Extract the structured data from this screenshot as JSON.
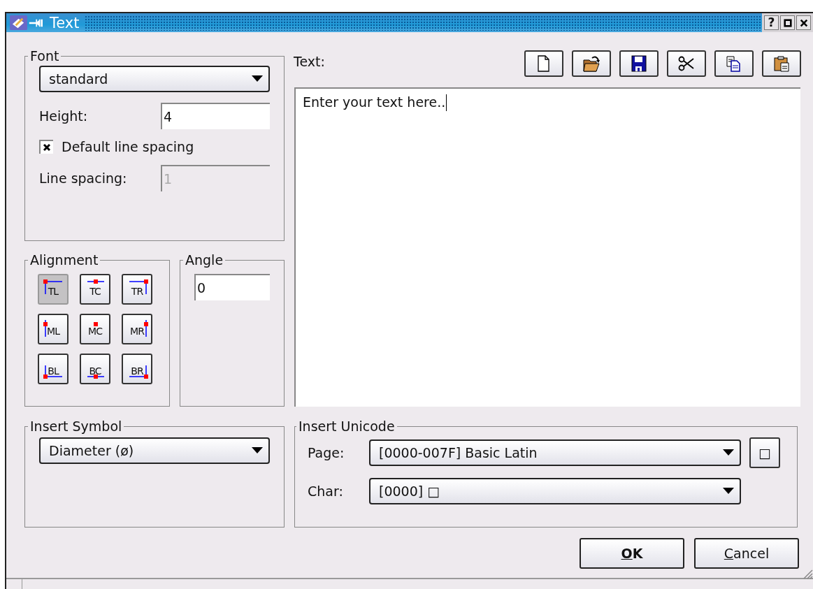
{
  "window": {
    "title": "Text"
  },
  "title_buttons": [
    {
      "kind": "help",
      "label": "?"
    },
    {
      "kind": "maximize"
    },
    {
      "kind": "close"
    }
  ],
  "font_group": {
    "title": "Font",
    "font": {
      "value": "standard"
    },
    "height": {
      "label": "Height:",
      "value": "4"
    },
    "default_spacing": {
      "label": "Default line spacing",
      "checked": true
    },
    "line_spacing": {
      "label": "Line spacing:",
      "value": "1",
      "disabled": true
    }
  },
  "alignment_group": {
    "title": "Alignment",
    "buttons": [
      {
        "label": "TL",
        "selected": true
      },
      {
        "label": "TC",
        "selected": false
      },
      {
        "label": "TR",
        "selected": false
      },
      {
        "label": "ML",
        "selected": false
      },
      {
        "label": "MC",
        "selected": false
      },
      {
        "label": "MR",
        "selected": false
      },
      {
        "label": "BL",
        "selected": false
      },
      {
        "label": "BC",
        "selected": false
      },
      {
        "label": "BR",
        "selected": false
      }
    ]
  },
  "angle_group": {
    "title": "Angle",
    "value": "0"
  },
  "text_panel": {
    "label": "Text:",
    "toolbar": [
      {
        "kind": "new"
      },
      {
        "kind": "open"
      },
      {
        "kind": "save"
      },
      {
        "kind": "cut"
      },
      {
        "kind": "copy"
      },
      {
        "kind": "paste"
      }
    ],
    "content": "Enter your text here.."
  },
  "symbol_group": {
    "title": "Insert Symbol",
    "value": "Diameter (ø)"
  },
  "unicode_group": {
    "title": "Insert Unicode",
    "page": {
      "label": "Page:",
      "value": "[0000-007F] Basic Latin"
    },
    "insert": {
      "label": "□"
    },
    "char": {
      "label": "Char:",
      "value": "[0000] □"
    }
  },
  "buttons": [
    {
      "label": "OK",
      "bold": true,
      "underline_first": true
    },
    {
      "label": "Cancel",
      "bold": false,
      "underline_first": true
    }
  ]
}
